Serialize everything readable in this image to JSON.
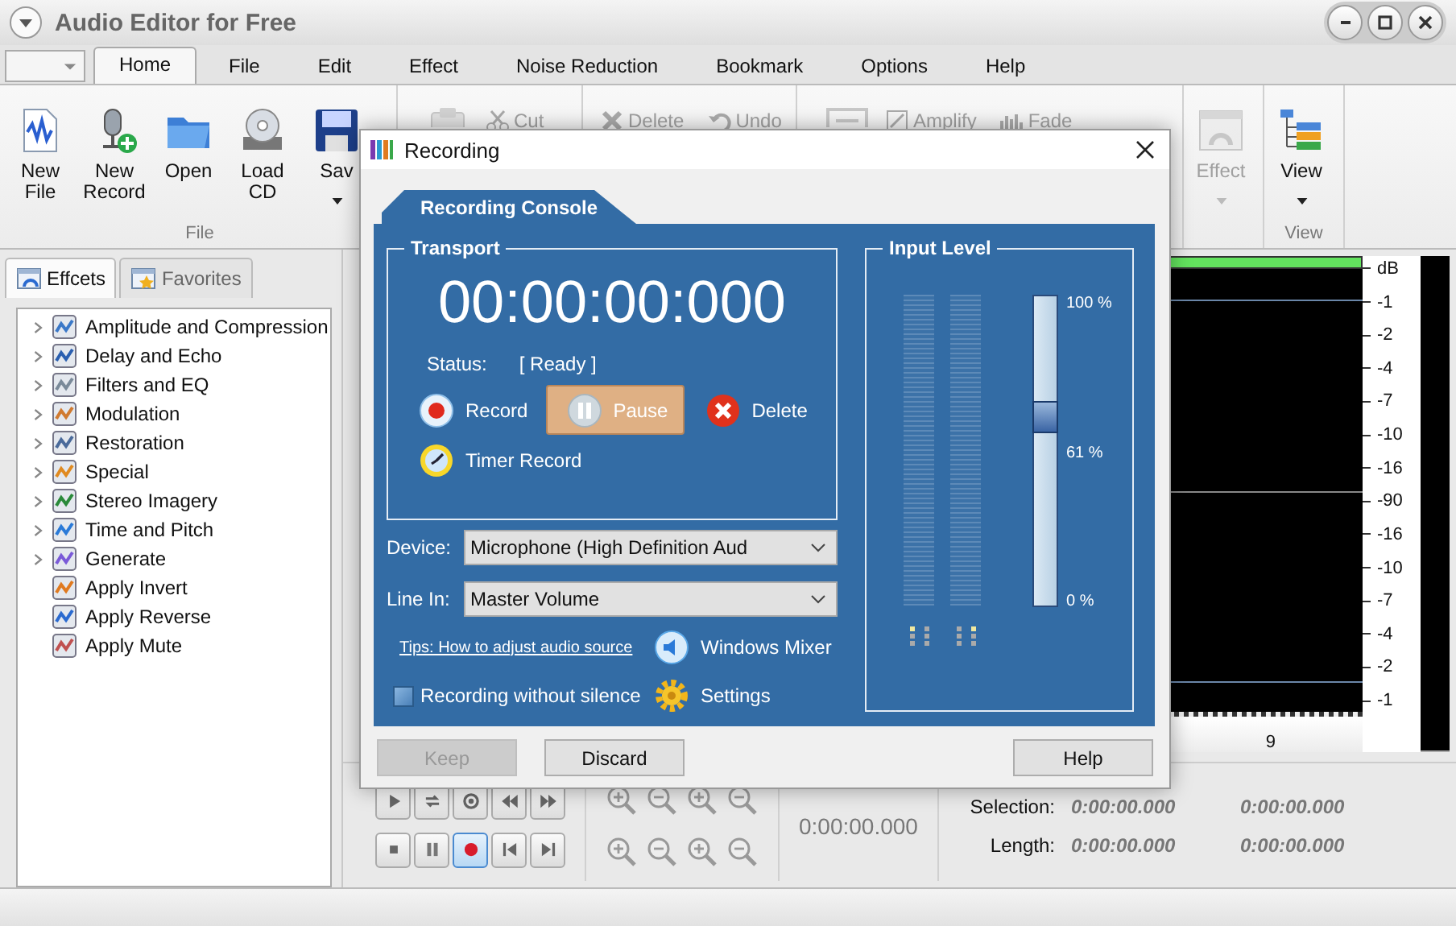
{
  "window": {
    "title": "Audio Editor for Free"
  },
  "menu_tabs": [
    {
      "label": "Home",
      "selected": true
    },
    {
      "label": "File",
      "selected": false
    },
    {
      "label": "Edit",
      "selected": false
    },
    {
      "label": "Effect",
      "selected": false
    },
    {
      "label": "Noise Reduction",
      "selected": false
    },
    {
      "label": "Bookmark",
      "selected": false
    },
    {
      "label": "Options",
      "selected": false
    },
    {
      "label": "Help",
      "selected": false
    }
  ],
  "ribbon_groups": [
    {
      "label": "File",
      "items": [
        {
          "kind": "large",
          "lines": [
            "New",
            "File"
          ],
          "disabled": false,
          "dropdown": false
        },
        {
          "kind": "large",
          "lines": [
            "New",
            "Record"
          ],
          "disabled": false,
          "dropdown": false
        },
        {
          "kind": "large",
          "lines": [
            "Open"
          ],
          "disabled": false,
          "dropdown": false
        },
        {
          "kind": "large",
          "lines": [
            "Load",
            "CD"
          ],
          "disabled": false,
          "dropdown": false
        },
        {
          "kind": "large",
          "lines": [
            "Sav"
          ],
          "disabled": false,
          "dropdown": true
        }
      ]
    },
    {
      "items": [
        {
          "kind": "large",
          "disabled": true,
          "dropdown": false
        },
        {
          "kind": "small",
          "label": "Cut",
          "disabled": true
        }
      ]
    },
    {
      "items": [
        {
          "kind": "small",
          "label": "Delete",
          "disabled": true
        },
        {
          "kind": "small",
          "label": "Undo",
          "disabled": true
        }
      ]
    },
    {
      "items": [
        {
          "kind": "large",
          "disabled": true,
          "dropdown": false
        },
        {
          "kind": "small",
          "label": "Amplify",
          "disabled": true
        },
        {
          "kind": "small",
          "label": "Fade",
          "disabled": true
        }
      ]
    },
    {
      "items": [
        {
          "kind": "large",
          "lines": [
            "Effect"
          ],
          "disabled": true,
          "dropdown": true
        }
      ]
    },
    {
      "label": "View",
      "items": [
        {
          "kind": "large",
          "lines": [
            "View"
          ],
          "disabled": false,
          "dropdown": true
        }
      ]
    }
  ],
  "left_panel": {
    "tabs": [
      {
        "label": "Effcets",
        "selected": true
      },
      {
        "label": "Favorites",
        "selected": false
      }
    ],
    "tree": [
      {
        "label": "Amplitude and Compression",
        "kind": "folder",
        "expanded": false
      },
      {
        "label": "Delay and Echo",
        "kind": "folder",
        "expanded": false
      },
      {
        "label": "Filters and EQ",
        "kind": "folder",
        "expanded": false
      },
      {
        "label": "Modulation",
        "kind": "folder",
        "expanded": false
      },
      {
        "label": "Restoration",
        "kind": "folder",
        "expanded": false
      },
      {
        "label": "Special",
        "kind": "folder",
        "expanded": false
      },
      {
        "label": "Stereo Imagery",
        "kind": "folder",
        "expanded": false
      },
      {
        "label": "Time and Pitch",
        "kind": "folder",
        "expanded": false
      },
      {
        "label": "Generate",
        "kind": "folder",
        "expanded": false
      },
      {
        "label": "Apply Invert",
        "kind": "action"
      },
      {
        "label": "Apply Reverse",
        "kind": "action"
      },
      {
        "label": "Apply Mute",
        "kind": "action"
      }
    ]
  },
  "waveform": {
    "scale_labels": [
      "dB",
      "-1",
      "-2",
      "-4",
      "-7",
      "-10",
      "-16",
      "-90",
      "-16",
      "-10",
      "-7",
      "-4",
      "-2",
      "-1"
    ],
    "ruler_labels": [
      "9"
    ]
  },
  "transport_bar": [
    {
      "kind": "play",
      "selected": false
    },
    {
      "kind": "repeat",
      "selected": false
    },
    {
      "kind": "circle",
      "selected": false
    },
    {
      "kind": "rewind",
      "selected": false
    },
    {
      "kind": "forward",
      "selected": false
    },
    {
      "kind": "stop",
      "selected": false
    },
    {
      "kind": "pause",
      "selected": false
    },
    {
      "kind": "record",
      "selected": true
    },
    {
      "kind": "previous",
      "selected": false
    },
    {
      "kind": "next",
      "selected": false
    }
  ],
  "time_display": "0:00:00.000",
  "selection_info": [
    {
      "label": "Selection:",
      "start": "0:00:00.000",
      "end": "0:00:00.000"
    },
    {
      "label": "Length:",
      "start": "0:00:00.000",
      "end": "0:00:00.000"
    }
  ],
  "dialog": {
    "title": "Recording",
    "tab": "Recording Console",
    "transport": {
      "legend": "Transport",
      "time": "00:00:00:000",
      "status_label": "Status:",
      "status": "[ Ready ]",
      "buttons": [
        {
          "kind": "record",
          "label": "Record",
          "selected": false
        },
        {
          "kind": "pause",
          "label": "Pause",
          "selected": true
        },
        {
          "kind": "delete",
          "label": "Delete",
          "selected": false
        },
        {
          "kind": "timer",
          "label": "Timer Record",
          "selected": false
        }
      ]
    },
    "device": {
      "label": "Device:",
      "value": "Microphone (High Definition Aud"
    },
    "line_in": {
      "label": "Line In:",
      "value": "Master Volume"
    },
    "tips_link": "Tips: How to adjust audio source",
    "windows_mixer": "Windows Mixer",
    "settings": "Settings",
    "silence_option": {
      "label": "Recording without silence",
      "checked": false
    },
    "input_level": {
      "legend": "Input Level",
      "level": 0.61,
      "labels": [
        "100 %",
        "61 %",
        "0 %"
      ]
    },
    "buttons": [
      {
        "label": "Keep",
        "disabled": true
      },
      {
        "label": "Discard",
        "disabled": false
      },
      {
        "label": "Help",
        "disabled": false
      }
    ]
  }
}
